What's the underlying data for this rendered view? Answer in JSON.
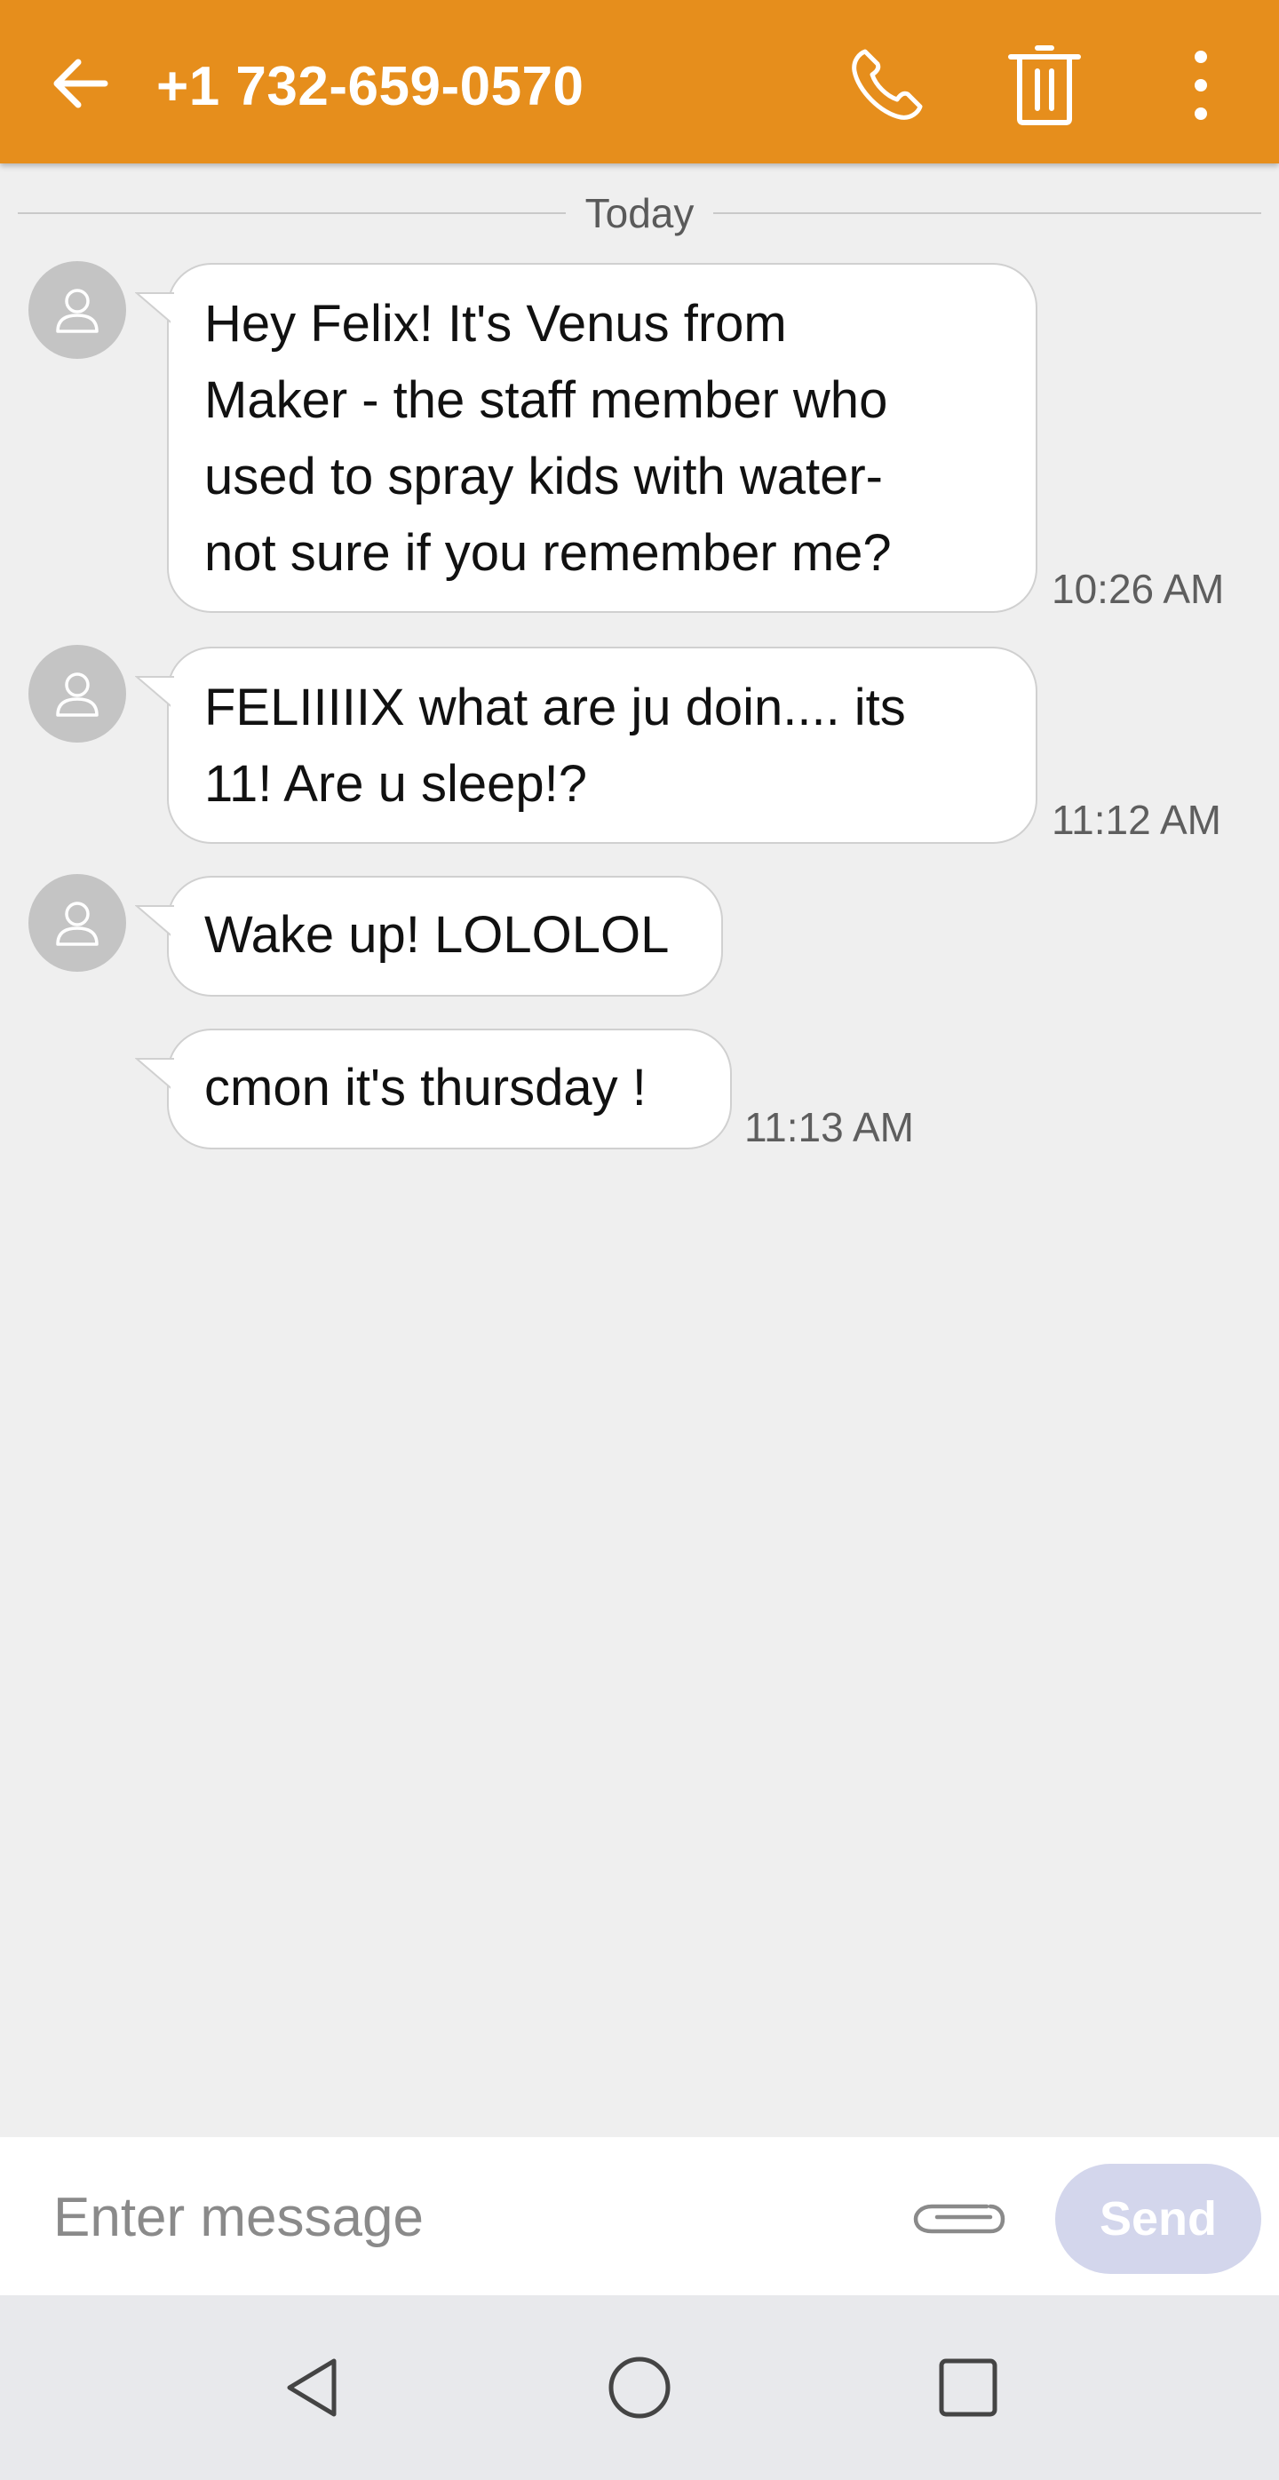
{
  "header": {
    "title": "+1 732-659-0570",
    "background_color": "#e68e1c",
    "icons": [
      "back-arrow-icon",
      "phone-icon",
      "trash-icon",
      "more-vertical-icon"
    ]
  },
  "conversation": {
    "date_divider": "Today",
    "messages": [
      {
        "text": "Hey Felix! It's Venus from Maker - the staff member who used to spray kids with water- not sure if you remember me?",
        "lines": [
          "Hey Felix! It's Venus from",
          "Maker - the staff member who",
          "used to spray kids with water-",
          "not sure if you remember me?"
        ],
        "time": "10:26 AM",
        "avatar": true
      },
      {
        "text": "FELIIIIIX what are ju doin.... its 11! Are u sleep!?",
        "lines": [
          "FELIIIIIX what are ju doin.... its",
          "11! Are u sleep!?"
        ],
        "time": "11:12 AM",
        "avatar": true
      },
      {
        "text": "Wake up! LOLOLOL",
        "lines": [
          "Wake up! LOLOLOL"
        ],
        "time": "",
        "avatar": true
      },
      {
        "text": "cmon it's thursday !",
        "lines": [
          "cmon it's thursday !"
        ],
        "time": "11:13 AM",
        "avatar": false
      }
    ]
  },
  "composer": {
    "placeholder": "Enter message",
    "value": "",
    "send_label": "Send",
    "attach_icon": "paperclip-icon"
  },
  "navbar": {
    "icons": [
      "nav-back-icon",
      "nav-home-icon",
      "nav-recents-icon"
    ]
  }
}
